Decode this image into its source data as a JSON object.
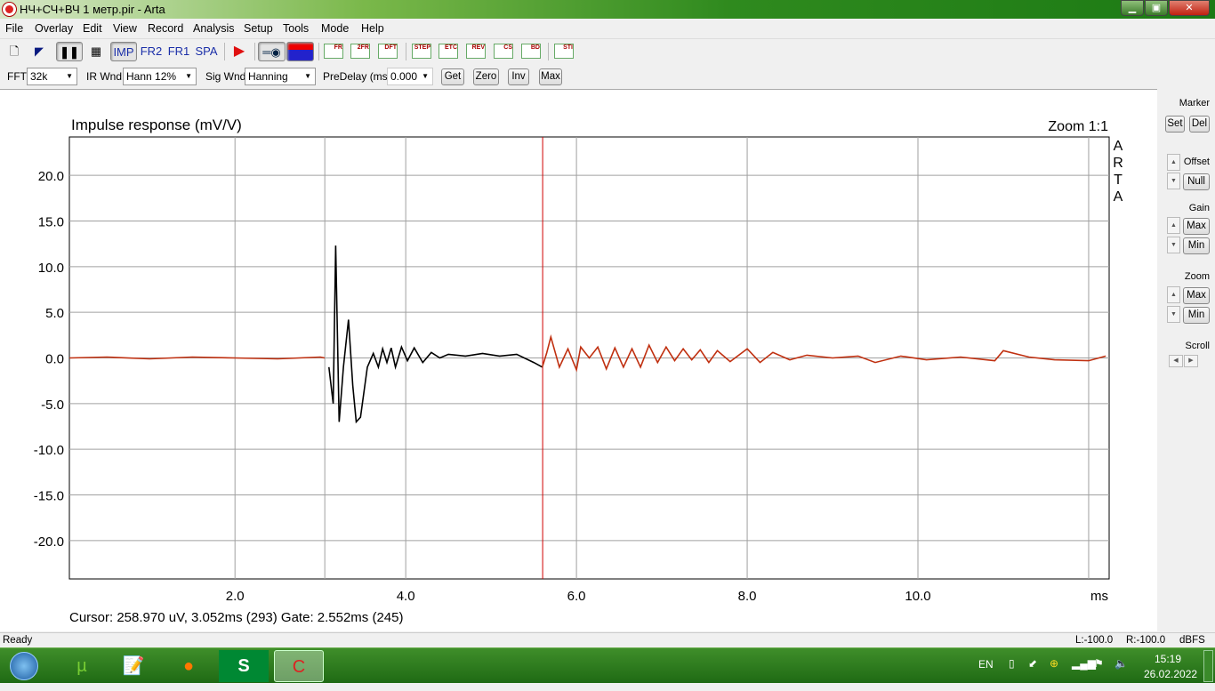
{
  "window": {
    "title": "НЧ+СЧ+ВЧ 1 метр.pir - Arta",
    "min": "▁",
    "max": "▣",
    "close": "✕"
  },
  "menu": [
    "File",
    "Overlay",
    "Edit",
    "View",
    "Record",
    "Analysis",
    "Setup",
    "Tools",
    "Mode",
    "Help"
  ],
  "toolbar": {
    "imp": "IMP",
    "fr2": "FR2",
    "fr1": "FR1",
    "spa": "SPA",
    "icons": [
      "FR",
      "2FR",
      "DFT",
      "STEP",
      "ETC",
      "REV",
      "CS",
      "BD",
      "STI"
    ]
  },
  "toolbar2": {
    "fft_label": "FFT",
    "fft_value": "32k",
    "irwnd_label": "IR Wnd",
    "irwnd_value": "Hann 12%",
    "sigwnd_label": "Sig Wnd",
    "sigwnd_value": "Hanning",
    "predelay_label": "PreDelay (ms)",
    "predelay_value": "0.000",
    "get": "Get",
    "zero": "Zero",
    "inv": "Inv",
    "max": "Max"
  },
  "right_panel": {
    "marker": "Marker",
    "set": "Set",
    "del": "Del",
    "offset": "Offset",
    "null": "Null",
    "gain": "Gain",
    "gain_max": "Max",
    "gain_min": "Min",
    "zoom": "Zoom",
    "zoom_max": "Max",
    "zoom_min": "Min",
    "scroll": "Scroll"
  },
  "readout": "Cursor: 258.970 uV, 3.052ms (293)  Gate: 2.552ms (245)",
  "status": {
    "ready": "Ready",
    "left": "L:-100.0",
    "right": "R:-100.0",
    "unit": "dBFS"
  },
  "taskbar": {
    "lang": "EN",
    "time": "15:19",
    "date": "26.02.2022"
  },
  "chart_data": {
    "type": "line",
    "title": "Impulse response (mV/V)",
    "zoom_label": "Zoom 1:1",
    "brand": "ARTA",
    "xlabel": "ms",
    "xlim": [
      0.06,
      12.24
    ],
    "ylim": [
      -24.2,
      24.2
    ],
    "xticks": [
      2,
      4,
      6,
      8,
      10,
      12
    ],
    "xtick_labels": [
      "2.0",
      "4.0",
      "6.0",
      "8.0",
      "10.0"
    ],
    "yticks": [
      20,
      15,
      10,
      5,
      0,
      -5,
      -10,
      -15,
      -20
    ],
    "ytick_labels": [
      "20.0",
      "15.0",
      "10.0",
      "5.0",
      "0.0",
      "-5.0",
      "-10.0",
      "-15.0",
      "-20.0"
    ],
    "cursor_ms": 3.052,
    "gate_end_ms": 5.604,
    "colors": {
      "in_gate": "#000000",
      "out_gate": "#c03010",
      "gate_line": "#d00000",
      "grid": "#a0a0a0"
    },
    "points": [
      [
        0.06,
        0
      ],
      [
        0.5,
        0.1
      ],
      [
        1,
        -0.1
      ],
      [
        1.5,
        0.1
      ],
      [
        2,
        0
      ],
      [
        2.5,
        -0.1
      ],
      [
        3.0,
        0.1
      ],
      [
        3.05,
        0
      ],
      [
        3.1,
        -1
      ],
      [
        3.15,
        -5
      ],
      [
        3.18,
        12.3
      ],
      [
        3.22,
        -7
      ],
      [
        3.27,
        -1
      ],
      [
        3.33,
        4.2
      ],
      [
        3.38,
        -3
      ],
      [
        3.42,
        -7
      ],
      [
        3.47,
        -6.5
      ],
      [
        3.55,
        -1
      ],
      [
        3.62,
        0.5
      ],
      [
        3.68,
        -1
      ],
      [
        3.73,
        1
      ],
      [
        3.78,
        -0.5
      ],
      [
        3.83,
        1.1
      ],
      [
        3.88,
        -1
      ],
      [
        3.95,
        1.2
      ],
      [
        4.02,
        -0.3
      ],
      [
        4.1,
        1.1
      ],
      [
        4.2,
        -0.5
      ],
      [
        4.3,
        0.6
      ],
      [
        4.4,
        0
      ],
      [
        4.5,
        0.4
      ],
      [
        4.7,
        0.2
      ],
      [
        4.9,
        0.5
      ],
      [
        5.1,
        0.2
      ],
      [
        5.3,
        0.4
      ],
      [
        5.5,
        -0.5
      ],
      [
        5.6,
        -1
      ],
      [
        5.65,
        0.5
      ],
      [
        5.7,
        2.3
      ],
      [
        5.8,
        -1
      ],
      [
        5.9,
        1.0
      ],
      [
        6.0,
        -1.3
      ],
      [
        6.05,
        1.2
      ],
      [
        6.15,
        0
      ],
      [
        6.25,
        1.2
      ],
      [
        6.35,
        -1.2
      ],
      [
        6.45,
        1.1
      ],
      [
        6.55,
        -1.0
      ],
      [
        6.65,
        1.0
      ],
      [
        6.75,
        -1
      ],
      [
        6.85,
        1.4
      ],
      [
        6.95,
        -0.5
      ],
      [
        7.05,
        1.2
      ],
      [
        7.15,
        -0.3
      ],
      [
        7.25,
        1
      ],
      [
        7.35,
        -0.2
      ],
      [
        7.45,
        0.9
      ],
      [
        7.55,
        -0.5
      ],
      [
        7.65,
        0.8
      ],
      [
        7.8,
        -0.4
      ],
      [
        8.0,
        1.0
      ],
      [
        8.15,
        -0.5
      ],
      [
        8.3,
        0.6
      ],
      [
        8.5,
        -0.2
      ],
      [
        8.7,
        0.3
      ],
      [
        9.0,
        0
      ],
      [
        9.3,
        0.2
      ],
      [
        9.5,
        -0.5
      ],
      [
        9.8,
        0.2
      ],
      [
        10.1,
        -0.2
      ],
      [
        10.5,
        0.1
      ],
      [
        10.9,
        -0.3
      ],
      [
        11.0,
        0.8
      ],
      [
        11.3,
        0.1
      ],
      [
        11.6,
        -0.2
      ],
      [
        12.0,
        -0.3
      ],
      [
        12.2,
        0.2
      ]
    ]
  }
}
